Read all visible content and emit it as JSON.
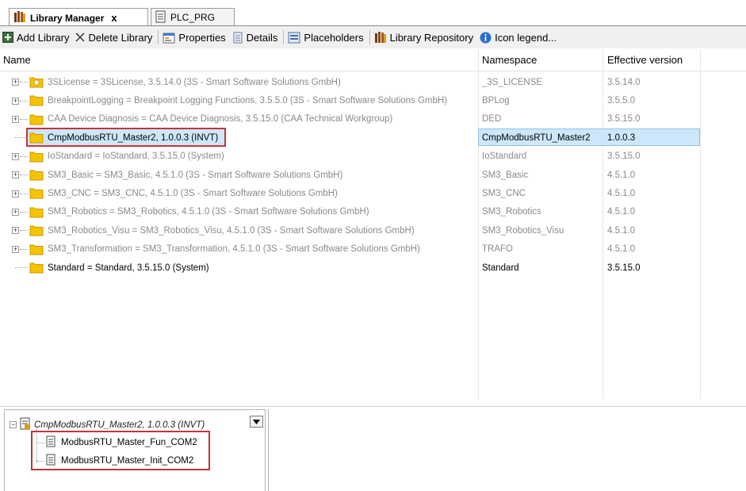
{
  "tabs": [
    {
      "label": "Library Manager",
      "close": "x",
      "active": true
    },
    {
      "label": "PLC_PRG",
      "active": false
    }
  ],
  "toolbar": {
    "add_library": "Add Library",
    "delete_library": "Delete Library",
    "properties": "Properties",
    "details": "Details",
    "placeholders": "Placeholders",
    "library_repository": "Library Repository",
    "icon_legend": "Icon legend..."
  },
  "grid": {
    "headers": {
      "name": "Name",
      "namespace": "Namespace",
      "version": "Effective version"
    },
    "rows": [
      {
        "name": "3SLicense = 3SLicense, 3.5.14.0 (3S - Smart Software Solutions GmbH)",
        "namespace": "_3S_LICENSE",
        "version": "3.5.14.0",
        "expandable": true,
        "icon": "license-folder-icon"
      },
      {
        "name": "BreakpointLogging = Breakpoint Logging Functions, 3.5.5.0 (3S - Smart Software Solutions GmbH)",
        "namespace": "BPLog",
        "version": "3.5.5.0",
        "expandable": true,
        "icon": "folder-icon"
      },
      {
        "name": "CAA Device Diagnosis = CAA Device Diagnosis, 3.5.15.0 (CAA Technical Workgroup)",
        "namespace": "DED",
        "version": "3.5.15.0",
        "expandable": true,
        "icon": "folder-icon"
      },
      {
        "name": "CmpModbusRTU_Master2, 1.0.0.3 (INVT)",
        "namespace": "CmpModbusRTU_Master2",
        "version": "1.0.0.3",
        "expandable": false,
        "selected": true,
        "icon": "folder-icon"
      },
      {
        "name": "IoStandard = IoStandard, 3.5.15.0 (System)",
        "namespace": "IoStandard",
        "version": "3.5.15.0",
        "expandable": true,
        "icon": "folder-icon"
      },
      {
        "name": "SM3_Basic = SM3_Basic, 4.5.1.0 (3S - Smart Software Solutions GmbH)",
        "namespace": "SM3_Basic",
        "version": "4.5.1.0",
        "expandable": true,
        "icon": "folder-icon"
      },
      {
        "name": "SM3_CNC = SM3_CNC, 4.5.1.0 (3S - Smart Software Solutions GmbH)",
        "namespace": "SM3_CNC",
        "version": "4.5.1.0",
        "expandable": true,
        "icon": "folder-icon"
      },
      {
        "name": "SM3_Robotics = SM3_Robotics, 4.5.1.0 (3S - Smart Software Solutions GmbH)",
        "namespace": "SM3_Robotics",
        "version": "4.5.1.0",
        "expandable": true,
        "icon": "folder-icon"
      },
      {
        "name": "SM3_Robotics_Visu = SM3_Robotics_Visu, 4.5.1.0 (3S - Smart Software Solutions GmbH)",
        "namespace": "SM3_Robotics_Visu",
        "version": "4.5.1.0",
        "expandable": true,
        "icon": "folder-icon"
      },
      {
        "name": "SM3_Transformation = SM3_Transformation, 4.5.1.0 (3S - Smart Software Solutions GmbH)",
        "namespace": "TRAFO",
        "version": "4.5.1.0",
        "expandable": true,
        "icon": "folder-icon"
      },
      {
        "name": "Standard = Standard, 3.5.15.0 (System)",
        "namespace": "Standard",
        "version": "3.5.15.0",
        "expandable": false,
        "system": true,
        "icon": "folder-icon"
      }
    ]
  },
  "bottom": {
    "library_root": "CmpModbusRTU_Master2, 1.0.0.3 (INVT)",
    "pous": [
      "ModbusRTU_Master_Fun_COM2",
      "ModbusRTU_Master_Init_COM2"
    ]
  },
  "colors": {
    "selection": "#cde7fa",
    "highlight_border": "#c8333a",
    "folder": "#f5c400"
  }
}
